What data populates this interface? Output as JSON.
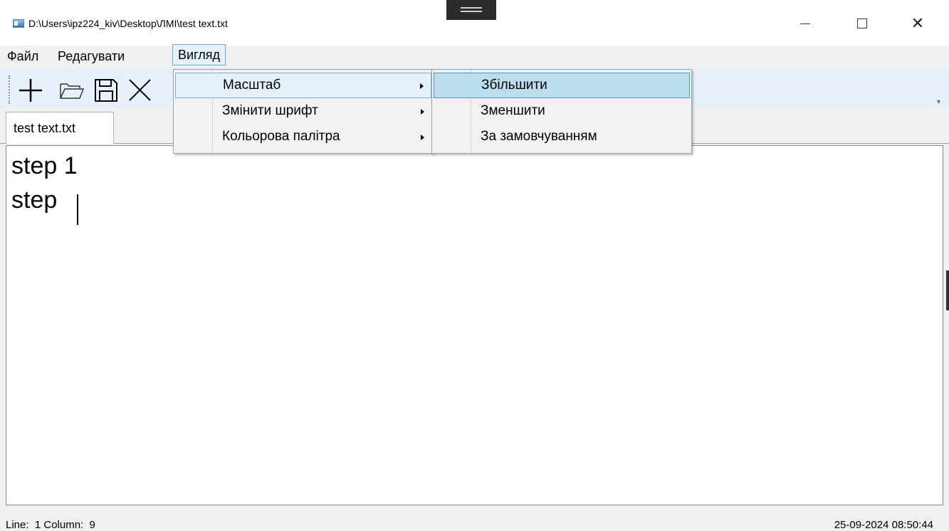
{
  "window": {
    "title": "D:\\Users\\ipz224_kiv\\Desktop\\ЛМІ\\test text.txt",
    "close_glyph": "✕"
  },
  "menubar": {
    "items": [
      "Файл",
      "Редагувати",
      "Вигляд"
    ],
    "active": "Вигляд"
  },
  "toolbar": {
    "icons": [
      "plus-icon",
      "folder-open-icon",
      "save-icon",
      "close-icon"
    ],
    "overflow_glyph": "▾"
  },
  "tabs": [
    {
      "label": "test text.txt",
      "active": true
    }
  ],
  "editor": {
    "lines": [
      "step 1",
      "step "
    ]
  },
  "view_menu": {
    "items": [
      {
        "label": "Масштаб",
        "has_submenu": true,
        "highlighted": true
      },
      {
        "label": "Змінити шрифт",
        "has_submenu": true,
        "highlighted": false
      },
      {
        "label": "Кольорова палітра",
        "has_submenu": true,
        "highlighted": false
      }
    ]
  },
  "zoom_submenu": {
    "items": [
      {
        "label": "Збільшити",
        "selected": true
      },
      {
        "label": "Зменшити",
        "selected": false
      },
      {
        "label": "За замовчуванням",
        "selected": false
      }
    ]
  },
  "statusbar": {
    "position": "Line:  1 Column:  9",
    "datetime": "25-09-2024 08:50:44"
  },
  "colors": {
    "menu_highlight": "#e5f1fb",
    "menu_selected": "#bcdcef",
    "toolbar_bg": "#e8f1f9"
  }
}
